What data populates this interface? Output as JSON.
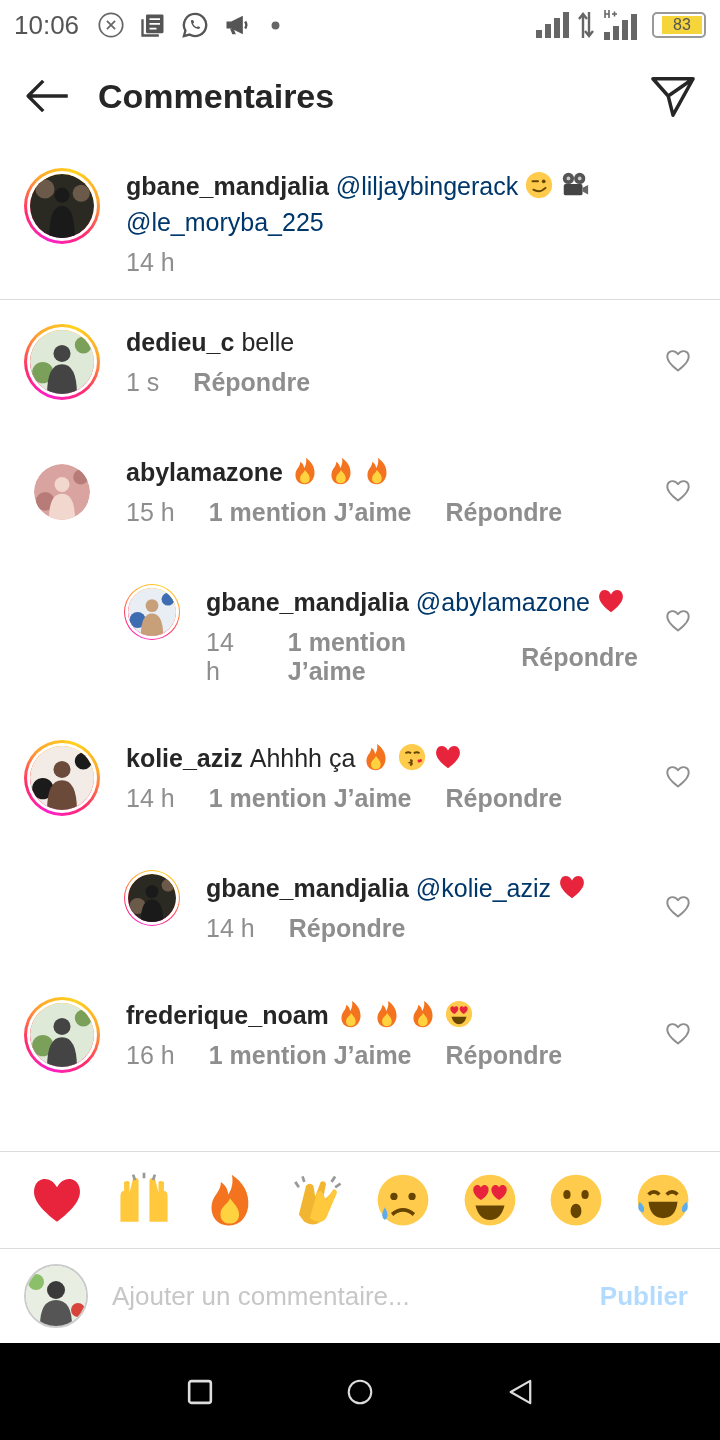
{
  "status_bar": {
    "time": "10:06",
    "battery": "83"
  },
  "header": {
    "title": "Commentaires"
  },
  "caption": {
    "username": "gbane_mandjalia",
    "story_ring": true,
    "body": [
      {
        "kind": "mention",
        "text": "@liljaybingerack"
      },
      {
        "kind": "wink"
      },
      {
        "kind": "camera"
      },
      {
        "kind": "mention",
        "text": "@le_moryba_225"
      }
    ],
    "time": "14 h"
  },
  "comments": [
    {
      "username": "dedieu_c",
      "story_ring": true,
      "reply": false,
      "body": [
        {
          "kind": "text",
          "text": "belle"
        }
      ],
      "time": "1 s",
      "reply_label": "Répondre"
    },
    {
      "username": "abylamazone",
      "story_ring": false,
      "reply": false,
      "body": [
        {
          "kind": "fire"
        },
        {
          "kind": "fire"
        },
        {
          "kind": "fire"
        }
      ],
      "time": "15 h",
      "likes": "1 mention J’aime",
      "reply_label": "Répondre"
    },
    {
      "username": "gbane_mandjalia",
      "story_ring": true,
      "reply": true,
      "body": [
        {
          "kind": "mention",
          "text": "@abylamazone"
        },
        {
          "kind": "heart"
        }
      ],
      "time": "14 h",
      "likes": "1 mention J’aime",
      "reply_label": "Répondre"
    },
    {
      "username": "kolie_aziz",
      "story_ring": true,
      "reply": false,
      "body": [
        {
          "kind": "text",
          "text": "Ahhhh ça"
        },
        {
          "kind": "fire"
        },
        {
          "kind": "kiss"
        },
        {
          "kind": "heart"
        }
      ],
      "time": "14 h",
      "likes": "1 mention J’aime",
      "reply_label": "Répondre"
    },
    {
      "username": "gbane_mandjalia",
      "story_ring": true,
      "reply": true,
      "body": [
        {
          "kind": "mention",
          "text": "@kolie_aziz"
        },
        {
          "kind": "heart"
        }
      ],
      "time": "14 h",
      "reply_label": "Répondre"
    },
    {
      "username": "frederique_noam",
      "story_ring": true,
      "reply": false,
      "body": [
        {
          "kind": "fire"
        },
        {
          "kind": "fire"
        },
        {
          "kind": "fire"
        },
        {
          "kind": "heart_eyes"
        }
      ],
      "time": "16 h",
      "likes": "1 mention J’aime",
      "reply_label": "Répondre"
    }
  ],
  "reactions": [
    {
      "kind": "heart"
    },
    {
      "kind": "raised_hands"
    },
    {
      "kind": "fire"
    },
    {
      "kind": "clap"
    },
    {
      "kind": "sad"
    },
    {
      "kind": "heart_eyes"
    },
    {
      "kind": "surprised"
    },
    {
      "kind": "joy"
    }
  ],
  "composer": {
    "placeholder": "Ajouter un commentaire...",
    "post_label": "Publier"
  }
}
